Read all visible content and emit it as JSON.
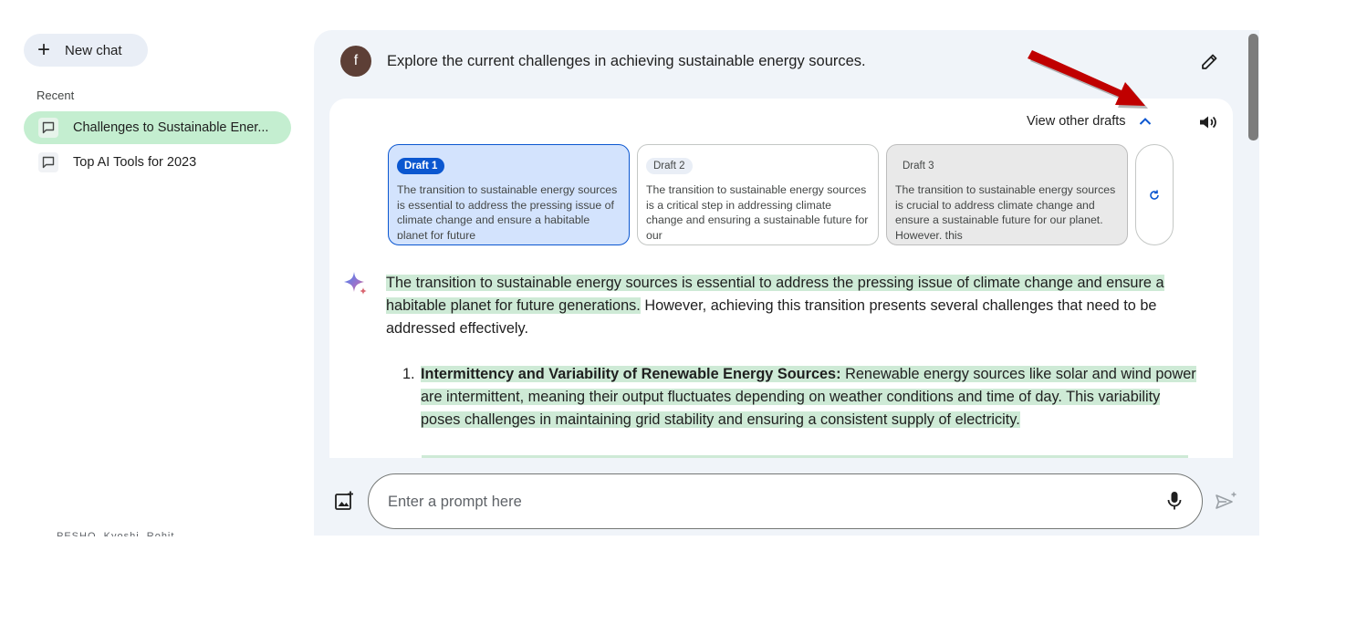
{
  "sidebar": {
    "new_chat_label": "New chat",
    "recent_label": "Recent",
    "items": [
      {
        "label": "Challenges to Sustainable Ener...",
        "active": true
      },
      {
        "label": "Top AI Tools for 2023",
        "active": false
      }
    ],
    "cut_text": "PESHO, Kyoshi, Rohit"
  },
  "conversation": {
    "avatar_letter": "f",
    "user_prompt": "Explore the current challenges in achieving sustainable energy sources.",
    "view_drafts_label": "View other drafts",
    "drafts": [
      {
        "label": "Draft 1",
        "text": "The transition to sustainable energy sources is essential to address the pressing issue of climate change and ensure a habitable planet for future"
      },
      {
        "label": "Draft 2",
        "text": "The transition to sustainable energy sources is a critical step in addressing climate change and ensuring a sustainable future for our"
      },
      {
        "label": "Draft 3",
        "text": "The transition to sustainable energy sources is crucial to address climate change and ensure a sustainable future for our planet. However, this"
      }
    ],
    "answer": {
      "intro_highlight": "The transition to sustainable energy sources is essential to address the pressing issue of climate change and ensure a habitable planet for future generations.",
      "intro_rest": " However, achieving this transition presents several challenges that need to be addressed effectively.",
      "items": [
        {
          "number": "1.",
          "title": "Intermittency and Variability of Renewable Energy Sources:",
          "body": " Renewable energy sources like solar and wind power are intermittent, meaning their output fluctuates depending on weather conditions and time of day. This variability poses challenges in maintaining grid stability and ensuring a consistent supply of electricity."
        }
      ]
    }
  },
  "input": {
    "placeholder": "Enter a prompt here"
  },
  "colors": {
    "active_item": "#c4eed0",
    "highlight": "#ceead6",
    "selected_draft": "#d3e3fd",
    "accent": "#0b57d0",
    "annotation_arrow": "#c00000"
  },
  "icons": [
    "plus-icon",
    "chat-bubble-icon",
    "edit-icon",
    "chevron-up-icon",
    "speaker-icon",
    "refresh-icon",
    "sparkle-icon",
    "image-upload-icon",
    "microphone-icon",
    "send-icon"
  ]
}
